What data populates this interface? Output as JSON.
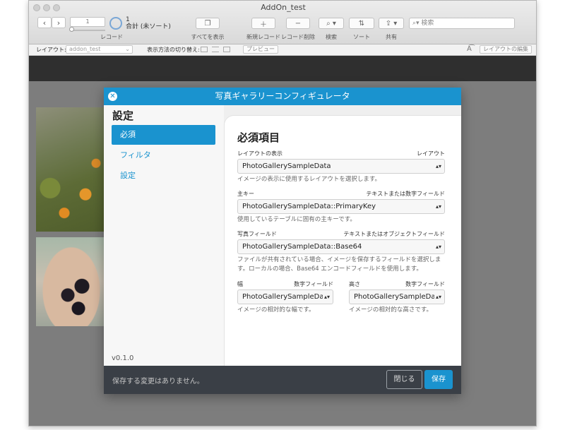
{
  "window": {
    "title": "AddOn_test"
  },
  "toolbar": {
    "record_field": "1",
    "record_count": "1",
    "record_total": "合計 (未ソート)",
    "record_label": "レコード",
    "show_all_label": "すべてを表示",
    "new_record_label": "新規レコード",
    "delete_record_label": "レコード削除",
    "find_label": "検索",
    "sort_label": "ソート",
    "share_label": "共有",
    "search_placeholder": "検索"
  },
  "layoutbar": {
    "layout_label": "レイアウト:",
    "layout_value": "addon_test",
    "view_as_label": "表示方法の切り替え:",
    "preview_label": "プレビュー",
    "edit_layout_label": "レイアウトの編集"
  },
  "dialog": {
    "title": "写真ギャラリーコンフィギュレータ",
    "settings_title": "設定",
    "nav": [
      {
        "label": "必須"
      },
      {
        "label": "フィルタ"
      },
      {
        "label": "設定"
      }
    ],
    "version": "v0.1.0",
    "section_title": "必須項目",
    "fields": {
      "layout": {
        "label": "レイアウトの表示",
        "type": "レイアウト",
        "value": "PhotoGallerySampleData",
        "help": "イメージの表示に使用するレイアウトを選択します。"
      },
      "primary_key": {
        "label": "主キー",
        "type": "テキストまたは数字フィールド",
        "value": "PhotoGallerySampleData::PrimaryKey",
        "help": "使用しているテーブルに固有の主キーです。"
      },
      "photo": {
        "label": "写真フィールド",
        "type": "テキストまたはオブジェクトフィールド",
        "value": "PhotoGallerySampleData::Base64",
        "help_line1": "ファイルが共有されている場合、イメージを保存するフィールドを選択しま",
        "help_line2": "す。ローカルの場合、Base64 エンコードフィールドを使用します。"
      },
      "width": {
        "label": "幅",
        "type": "数字フィールド",
        "value": "PhotoGallerySampleData::",
        "help": "イメージの相対的な幅です。"
      },
      "height": {
        "label": "高さ",
        "type": "数字フィールド",
        "value": "PhotoGallerySampleData::",
        "help": "イメージの相対的な高さです。"
      }
    },
    "footer": {
      "message": "保存する変更はありません。",
      "close_label": "閉じる",
      "save_label": "保存"
    }
  },
  "colors": {
    "accent": "#1a93cf",
    "footer_bg": "#3a3f46"
  }
}
